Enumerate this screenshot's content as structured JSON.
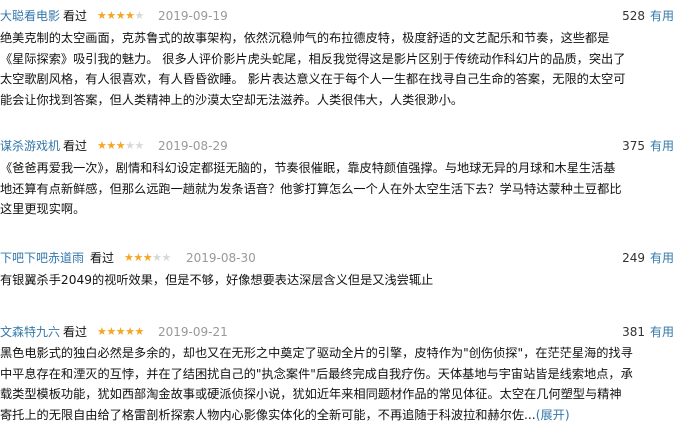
{
  "reviews": [
    {
      "user": "大聪看电影",
      "watched": "看过",
      "rating": 4,
      "date": "2019-09-19",
      "votes": "528",
      "useful": "有用",
      "lines": [
        "绝美克制的太空画面，克苏鲁式的故事架构，依然沉稳帅气的布拉德皮特，极度舒适的文艺配乐和节奏，这些都是",
        "《星际探索》吸引我的魅力。 很多人评价影片虎头蛇尾，相反我觉得这是影片区别于传统动作科幻片的品质，突出了",
        "太空歌剧风格，有人很喜欢，有人昏昏欲睡。 影片表达意义在于每个人一生都在找寻自己生命的答案，无限的太空可",
        "能会让你找到答案，但人类精神上的沙漠太空却无法滋养。人类很伟大，人类很渺小。"
      ]
    },
    {
      "user": "谋杀游戏机",
      "watched": "看过",
      "rating": 3,
      "date": "2019-08-29",
      "votes": "375",
      "useful": "有用",
      "lines": [
        "《爸爸再爱我一次》，剧情和科幻设定都挺无脑的，节奏很催眠，靠皮特颜值强撑。与地球无异的月球和木星生活基",
        "地还算有点新鲜感，但那么远跑一趟就为发条语音？他爹打算怎么一个人在外太空生活下去？学马特达蒙种土豆都比",
        "这里更现实啊。"
      ]
    },
    {
      "user": "下吧下吧赤道雨",
      "watched": "看过",
      "rating": 3,
      "date": "2019-08-30",
      "votes": "249",
      "useful": "有用",
      "lines": [
        "有银翼杀手2049的视听效果，但是不够，好像想要表达深层含义但是又浅尝辄止"
      ]
    },
    {
      "user": "文森特九六",
      "watched": "看过",
      "rating": 5,
      "date": "2019-09-21",
      "votes": "381",
      "useful": "有用",
      "lines": [
        "黑色电影式的独白必然是多余的，却也又在无形之中奠定了驱动全片的引擎，皮特作为\"创伤侦探\"，在茫茫星海的找寻",
        "中平息存在和湮灭的互悖，并在了结困扰自己的\"执念案件\"后最终完成自我疗伤。天体基地与宇宙站皆是线索地点，承",
        "载类型模板功能，犹如西部淘金故事或硬派侦探小说，犹如近年来相同题材作品的常见体征。太空在几何塑型与精神",
        "寄托上的无限自由给了格雷剖析探索人物内心影像实体化的全新可能，不再追随于科波拉和赫尔佐..."
      ],
      "more": "(展开)"
    }
  ]
}
